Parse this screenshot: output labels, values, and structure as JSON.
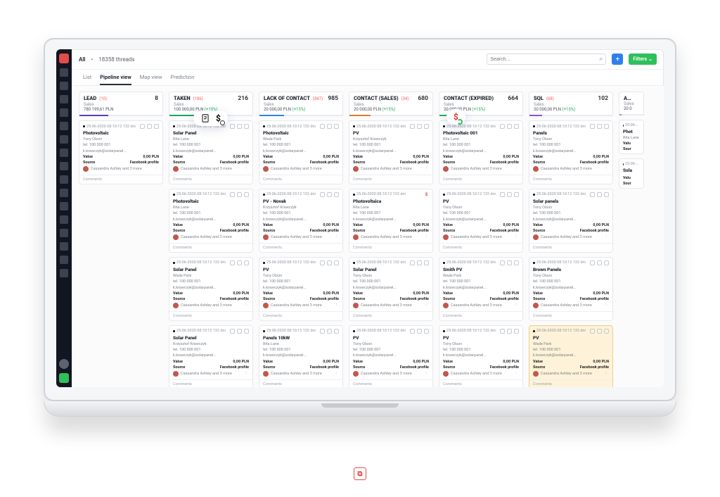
{
  "crumb": {
    "all": "All",
    "threads_count": "18358 threads"
  },
  "search": {
    "placeholder": "Search..."
  },
  "buttons": {
    "filters": "Filters"
  },
  "tabs": [
    "List",
    "Pipeline view",
    "Map view",
    "Prediction"
  ],
  "active_tab": 1,
  "columns": [
    {
      "name": "LEAD",
      "badge": "(10)",
      "count": "8",
      "sub": "Sales",
      "sum": "780 199,61 PLN",
      "accent": "#5a3cc0",
      "progress": 0.35
    },
    {
      "name": "TAKEN",
      "badge": "(186)",
      "count": "216",
      "sub": "Sales",
      "sum": "100 000,00 PLN (+15%)",
      "accent": "#18a957",
      "progress": 0.5
    },
    {
      "name": "LACK OF CONTACT",
      "badge": "(847)",
      "count": "985",
      "sub": "Sales",
      "sum": "20 000,00 PLN (+15%)",
      "accent": "#2f80ed",
      "progress": 0.3
    },
    {
      "name": "CONTACT (SALES)",
      "badge": "(34)",
      "count": "680",
      "sub": "Sales",
      "sum": "20 000,00 PLN (+15%)",
      "accent": "#e47c2a",
      "progress": 0.25
    },
    {
      "name": "CONTACT (EXPIRED)",
      "badge": "",
      "count": "664",
      "sub": "Sales",
      "sum": "20 000,00 PLN (+15%)",
      "accent": "#1fb25a",
      "progress": 0.2
    },
    {
      "name": "SQL",
      "badge": "(68)",
      "count": "102",
      "sub": "Sales",
      "sum": "20 000,00 PLN (+15%)",
      "accent": "#8d51d6",
      "progress": 0.15
    },
    {
      "name": "AUC",
      "badge": "",
      "count": "",
      "sub": "Sales",
      "sum": "20 0",
      "accent": "#96a0ae",
      "progress": 0.1
    }
  ],
  "card_common": {
    "date": "25-06-2020  08:10:12  132 dni",
    "tel": "tel. 100 000 001",
    "email": "k.krawczyk@solarpanel...",
    "value_label": "Value",
    "value": "0,00 PLN",
    "source_label": "Source",
    "source": "Facebook profile",
    "assignee": "Cassandra Ashley and 3 more",
    "comments": "Comments"
  },
  "people": {
    "tony": "Tony Olson",
    "rita": "Rita Lane",
    "wade": "Wade Park",
    "kr": "Krzysztof Krawczyk"
  },
  "cards": {
    "c0": [
      {
        "t": "Photovoltaic",
        "p": "tony"
      }
    ],
    "c1": [
      {
        "t": "Solar Panel",
        "p": "rita"
      },
      {
        "t": "Photovoltaic",
        "p": "rita"
      },
      {
        "t": "Solar Panel",
        "p": "wade"
      },
      {
        "t": "Solar Panel",
        "p": "kr"
      }
    ],
    "c2": [
      {
        "t": "Photovoltaic",
        "p": "wade"
      },
      {
        "t": "PV - Novak",
        "p": "kr"
      },
      {
        "t": "PV",
        "p": "tony"
      },
      {
        "t": "Panels 10kW",
        "p": "rita"
      }
    ],
    "c3": [
      {
        "t": "PV",
        "p": "kr"
      },
      {
        "t": "Photovoltaica",
        "p": "rita",
        "alert": true
      },
      {
        "t": "Solar Panel",
        "p": "tony"
      },
      {
        "t": "PV",
        "p": "tony"
      }
    ],
    "c4": [
      {
        "t": "Photovoltaic 001",
        "p": "rita"
      },
      {
        "t": "PV",
        "p": "tony"
      },
      {
        "t": "Smith PV",
        "p": "wade"
      },
      {
        "t": "PV",
        "p": "tony"
      }
    ],
    "c5": [
      {
        "t": "Panels",
        "p": "tony"
      },
      {
        "t": "Solar panels",
        "p": "tony"
      },
      {
        "t": "Brown Panels",
        "p": "tony"
      },
      {
        "t": "PV",
        "p": "wade",
        "hl": true
      }
    ],
    "c6": [
      {
        "t": "Phot",
        "p": "rita",
        "cut": true
      },
      {
        "t": "Sola",
        "p": "",
        "cut": true
      }
    ]
  }
}
